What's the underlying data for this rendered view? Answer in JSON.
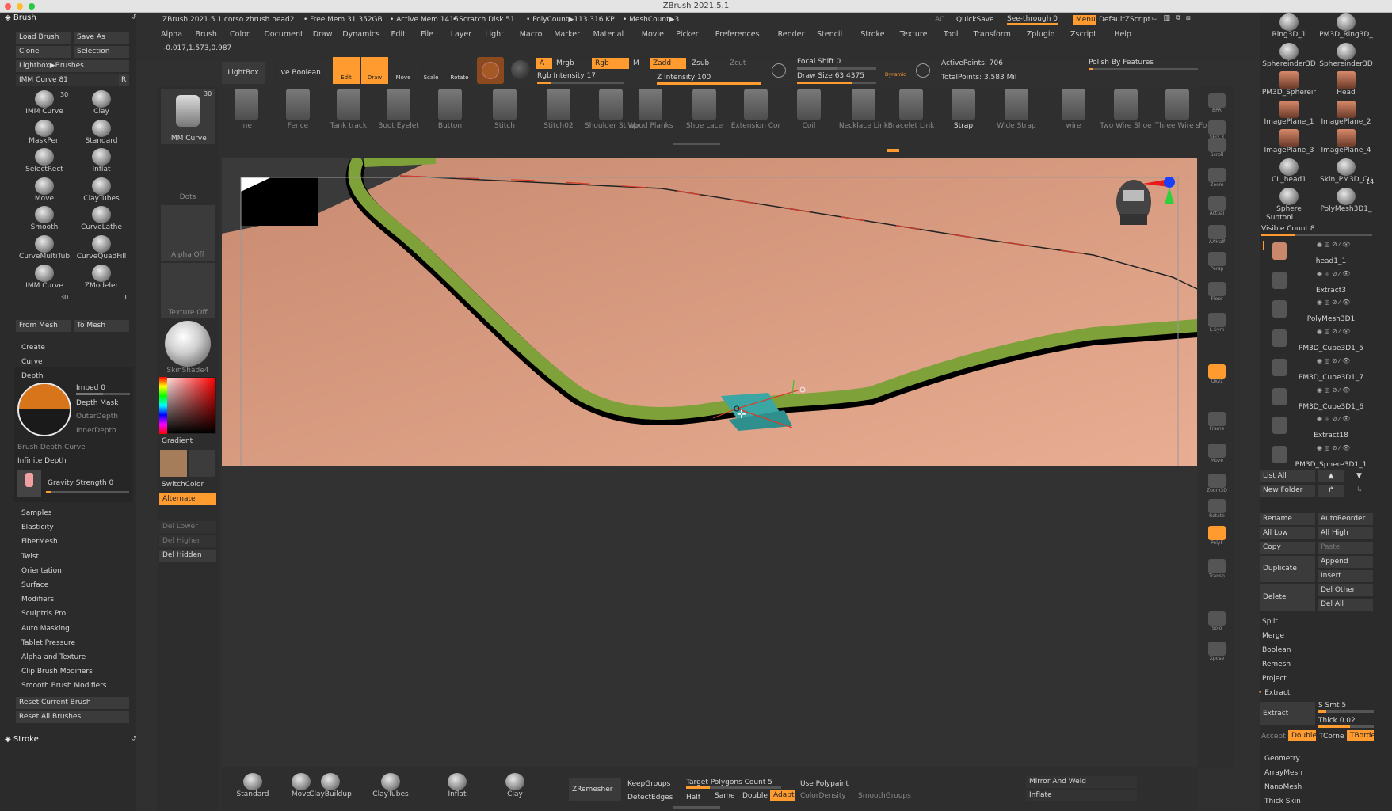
{
  "window": {
    "title": "ZBrush 2021.5.1"
  },
  "status": {
    "doc": "ZBrush 2021.5.1 corso zbrush head2",
    "free_mem": "• Free Mem 31.352GB",
    "active_mem": "• Active Mem 1415",
    "scratch": "• Scratch Disk 51",
    "polycount": "• PolyCount▶113.316 KP",
    "meshcount": "• MeshCount▶3",
    "ac": "AC",
    "quicksave": "QuickSave",
    "see_through": "See-through  0",
    "menus": "Menus",
    "default_zscript": "DefaultZScript"
  },
  "menubar": [
    "Alpha",
    "Brush",
    "Color",
    "Document",
    "Draw",
    "Dynamics",
    "Edit",
    "File",
    "Layer",
    "Light",
    "Macro",
    "Marker",
    "Material",
    "Movie",
    "Picker",
    "Preferences",
    "Render",
    "Stencil",
    "Stroke",
    "Texture",
    "Tool",
    "Transform",
    "Zplugin",
    "Zscript",
    "Help"
  ],
  "coords": "-0.017,1.573,0.987",
  "toolbar": {
    "lightbox": "LightBox",
    "live_boolean": "Live Boolean",
    "edit": "Edit",
    "draw": "Draw",
    "move": "Move",
    "scale": "Scale",
    "rotate": "Rotate",
    "a": "A",
    "mrgb": "Mrgb",
    "rgb": "Rgb",
    "m": "M",
    "zadd": "Zadd",
    "zsub": "Zsub",
    "zcut": "Zcut",
    "rgb_intensity": "Rgb Intensity 17",
    "z_intensity": "Z Intensity 100",
    "focal_shift": "Focal Shift 0",
    "draw_size": "Draw Size 63.4375",
    "dynamic": "Dynamic",
    "active_points": "ActivePoints: 706",
    "total_points": "TotalPoints: 3.583 Mil",
    "polish": "Polish By Features"
  },
  "shelf": [
    "ine",
    "Fence",
    "Tank track",
    "Boot Eyelet",
    "Button",
    "Stitch",
    "Stitch02",
    "Shoulder Strap",
    "Wood Planks",
    "Shoe Lace",
    "Extension Cor",
    "Coil",
    "Necklace Link",
    "Bracelet Link",
    "Strap",
    "Wide Strap",
    "wire",
    "Two Wire Shoe",
    "Three Wire s",
    "Fo"
  ],
  "left": {
    "header": "Brush",
    "load_brush": "Load Brush",
    "save_as": "Save As",
    "clone": "Clone",
    "selection": "Selection",
    "lightbox_brushes": "Lightbox▶Brushes",
    "imm_curve": "IMM Curve  81",
    "r": "R",
    "brushes": [
      [
        "IMM Curve",
        "Clay"
      ],
      [
        "MaskPen",
        "Standard"
      ],
      [
        "SelectRect",
        "Inflat"
      ],
      [
        "Move",
        "ClayTubes"
      ],
      [
        "Smooth",
        "CurveLathe"
      ],
      [
        "CurveMultiTub",
        "CurveQuadFill"
      ],
      [
        "IMM Curve",
        "ZModeler"
      ]
    ],
    "badge30": "30",
    "badge1": "1",
    "from_mesh": "From Mesh",
    "to_mesh": "To Mesh",
    "create": "Create",
    "curve": "Curve",
    "depth": "Depth",
    "imbed": "Imbed 0",
    "depth_mask": "Depth Mask",
    "outer_depth": "OuterDepth",
    "inner_depth": "InnerDepth",
    "brush_depth_curve": "Brush Depth Curve",
    "infinite_depth": "Infinite Depth",
    "gravity": "Gravity Strength 0",
    "sections": [
      "Samples",
      "Elasticity",
      "FiberMesh",
      "Twist",
      "Orientation",
      "Surface",
      "Modifiers",
      "Sculptris Pro",
      "Auto Masking",
      "Tablet Pressure",
      "Alpha and Texture",
      "Clip Brush Modifiers",
      "Smooth Brush Modifiers"
    ],
    "reset_current": "Reset Current Brush",
    "reset_all": "Reset All Brushes",
    "stroke": "Stroke"
  },
  "left2": {
    "imm": "IMM Curve",
    "badge": "30",
    "dots": "Dots",
    "alpha_off": "Alpha Off",
    "texture_off": "Texture Off",
    "material": "SkinShade4",
    "gradient": "Gradient",
    "switchcolor": "SwitchColor",
    "alternate": "Alternate",
    "del_lower": "Del Lower",
    "del_higher": "Del Higher",
    "del_hidden": "Del Hidden"
  },
  "righttools": [
    "BPR",
    "SPix 3",
    "Scroll",
    "Zoom",
    "Actual",
    "AAHalf",
    "Persp",
    "Floor",
    "L.Sym",
    "Qxyz",
    "Frame",
    "Move",
    "Zoom3D",
    "Rotate",
    "PolyF",
    "Transp",
    "Solo",
    "Xpose"
  ],
  "right": {
    "thumbs": [
      [
        "Ring3D_1",
        "PM3D_Ring3D_"
      ],
      [
        "Sphereinder3D",
        "Sphereinder3D"
      ],
      [
        "PM3D_Sphereir",
        "Head"
      ],
      [
        "ImagePlane_1",
        "ImagePlane_2"
      ],
      [
        "ImagePlane_3",
        "ImagePlane_4"
      ],
      [
        "CL_head1",
        "Skin_PM3D_Cu"
      ],
      [
        "Sphere",
        "PolyMesh3D1_"
      ]
    ],
    "badge14": "14",
    "subtool": "Subtool",
    "visible_count": "Visible Count 8",
    "subtools": [
      "head1_1",
      "Extract3",
      "PolyMesh3D1",
      "PM3D_Cube3D1_5",
      "PM3D_Cube3D1_7",
      "PM3D_Cube3D1_6",
      "Extract18",
      "PM3D_Sphere3D1_1"
    ],
    "list_all": "List All",
    "new_folder": "New Folder",
    "rename": "Rename",
    "autoreorder": "AutoReorder",
    "all_low": "All Low",
    "all_high": "All High",
    "copy": "Copy",
    "paste": "Paste",
    "duplicate": "Duplicate",
    "append": "Append",
    "insert": "Insert",
    "delete": "Delete",
    "del_other": "Del Other",
    "del_all": "Del All",
    "split": "Split",
    "merge": "Merge",
    "boolean": "Boolean",
    "remesh": "Remesh",
    "project": "Project",
    "extract_section": "Extract",
    "extract_btn": "Extract",
    "s_smt": "S Smt 5",
    "thick": "Thick 0.02",
    "accept": "Accept",
    "double": "Double",
    "tcorne": "TCorne",
    "tborde": "TBorde",
    "geometry": "Geometry",
    "arraymesh": "ArrayMesh",
    "nanomesh": "NanoMesh",
    "thick_skin": "Thick Skin"
  },
  "bottom": {
    "brushes": [
      "Standard",
      "Move",
      "ClayBuildup",
      "ClayTubes",
      "Inflat",
      "Clay"
    ],
    "zremesher": "ZRemesher",
    "keepgroups": "KeepGroups",
    "detectedges": "DetectEdges",
    "target": "Target Polygons Count 5",
    "half": "Half",
    "same": "Same",
    "double": "Double",
    "adapt": "Adapt",
    "use_polypaint": "Use Polypaint",
    "color_density": "ColorDensity",
    "smooth_groups": "SmoothGroups",
    "mirror_weld": "Mirror And Weld",
    "inflate": "Inflate"
  },
  "colors": {
    "accent": "#ff9b2f",
    "skin": "#e4a488",
    "strip_green": "#7fa13a",
    "teal": "#3aa7a4"
  }
}
